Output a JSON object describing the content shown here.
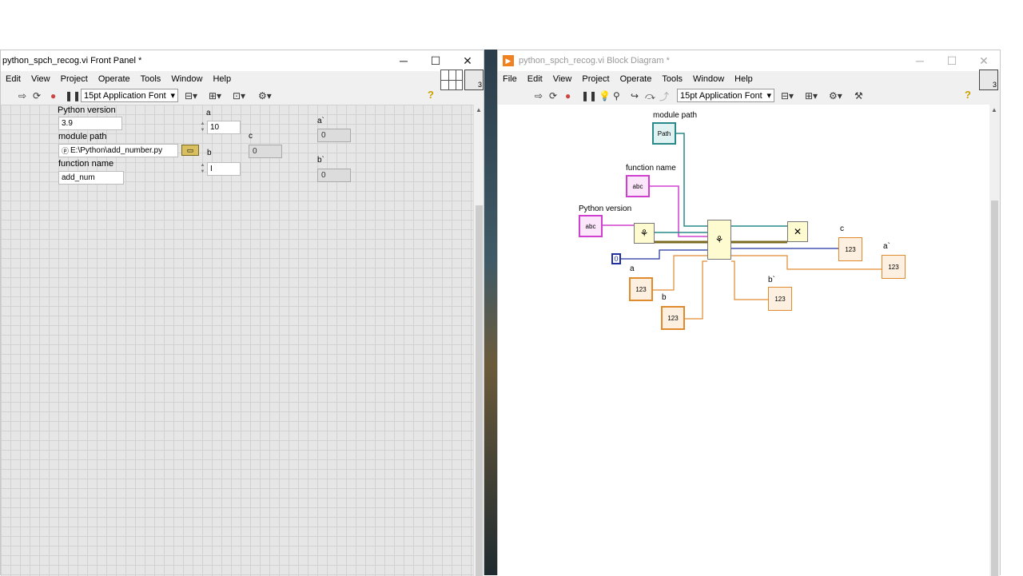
{
  "front_panel": {
    "title": "python_spch_recog.vi Front Panel *",
    "window_buttons": {
      "minimize": "─",
      "maximize": "☐",
      "close": "✕"
    },
    "menu": [
      "Edit",
      "View",
      "Project",
      "Operate",
      "Tools",
      "Window",
      "Help"
    ],
    "toolbar": {
      "font": "15pt Application Font",
      "connector_count": "3"
    },
    "controls": {
      "python_version": {
        "label": "Python version",
        "value": "3.9"
      },
      "module_path": {
        "label": "module path",
        "value": "E:\\Python\\add_number.py"
      },
      "function_name": {
        "label": "function name",
        "value": "add_num"
      },
      "a": {
        "label": "a",
        "value": "10"
      },
      "b": {
        "label": "b",
        "value": "I"
      },
      "c": {
        "label": "c",
        "value": "0"
      },
      "a_out": {
        "label": "a`",
        "value": "0"
      },
      "b_out": {
        "label": "b`",
        "value": "0"
      }
    }
  },
  "block_diagram": {
    "title": "python_spch_recog.vi Block Diagram *",
    "window_buttons": {
      "minimize": "─",
      "maximize": "☐",
      "close": "✕"
    },
    "menu": [
      "File",
      "Edit",
      "View",
      "Project",
      "Operate",
      "Tools",
      "Window",
      "Help"
    ],
    "toolbar": {
      "font": "15pt Application Font",
      "connector_count": "3"
    },
    "labels": {
      "module_path": "module path",
      "function_name": "function name",
      "python_version": "Python version",
      "a": "a",
      "b": "b",
      "c": "c",
      "a_out": "a`",
      "b_out": "b`"
    },
    "terminals": {
      "path": "Path",
      "str": "abc",
      "num": "123",
      "const_zero": "0"
    }
  },
  "colors": {
    "path_wire": "#2a8a8a",
    "string_wire": "#d040d0",
    "numeric_wire": "#e08a30",
    "int_wire": "#2030a0"
  }
}
